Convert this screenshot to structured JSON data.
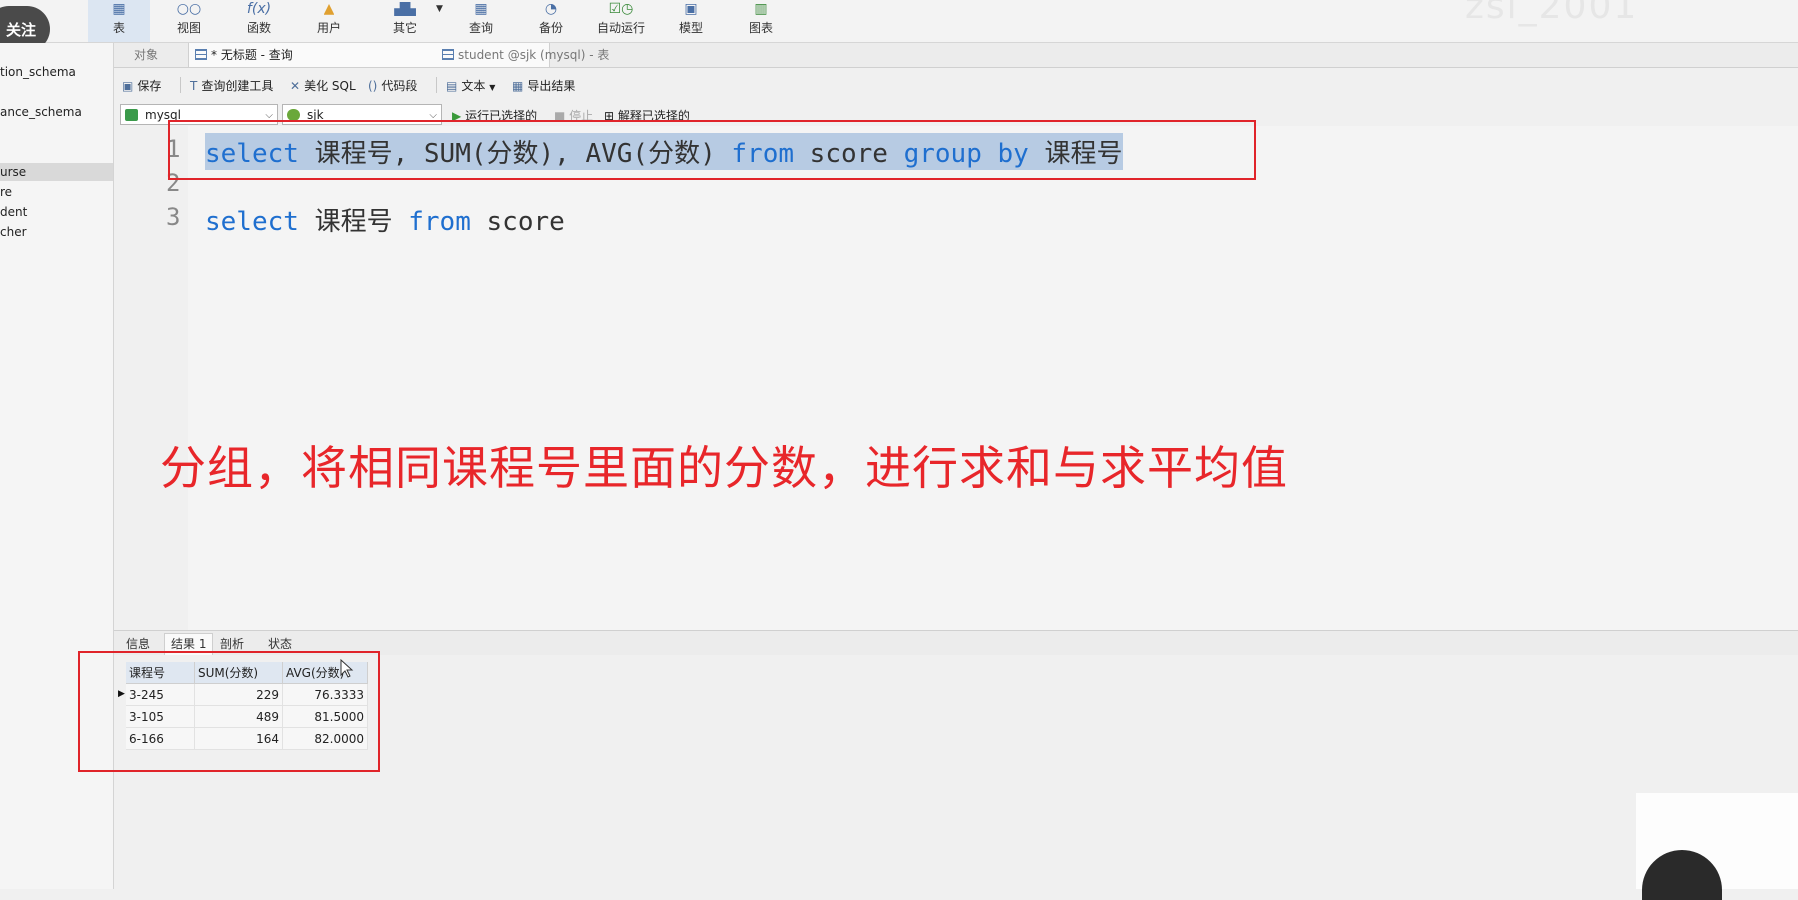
{
  "ribbon": {
    "follow_badge": "关注",
    "watermark": "zsl_2001",
    "buttons": [
      {
        "label": "表",
        "icon": "table-icon"
      },
      {
        "label": "视图",
        "icon": "view-icon"
      },
      {
        "label": "函数",
        "icon": "function-icon",
        "glyph": "f(x)"
      },
      {
        "label": "用户",
        "icon": "user-icon"
      },
      {
        "label": "其它",
        "icon": "other-icon"
      },
      {
        "label": "查询",
        "icon": "query-icon"
      },
      {
        "label": "备份",
        "icon": "backup-icon"
      },
      {
        "label": "自动运行",
        "icon": "auto-run-icon"
      },
      {
        "label": "模型",
        "icon": "model-icon"
      },
      {
        "label": "图表",
        "icon": "chart-icon"
      }
    ]
  },
  "navigator": {
    "items": [
      {
        "label": "tion_schema"
      },
      {
        "label": "ance_schema"
      },
      {
        "label": "urse"
      },
      {
        "label": "re"
      },
      {
        "label": "dent"
      },
      {
        "label": "cher"
      }
    ]
  },
  "tabs": [
    {
      "label": "对象"
    },
    {
      "label": "* 无标题 - 查询"
    },
    {
      "label": "student @sjk (mysql) - 表"
    }
  ],
  "toolbar": {
    "save": "保存",
    "query_builder": "查询创建工具",
    "beautify": "美化 SQL",
    "snippet": "代码段",
    "text": "文本",
    "export": "导出结果"
  },
  "selectors": {
    "connection": "mysql",
    "database": "sjk",
    "run_selected": "运行已选择的",
    "stop": "停止",
    "explain_selected": "解释已选择的"
  },
  "editor": {
    "lines": [
      {
        "no": "1",
        "select": "select",
        "text1": " 课程号, SUM(分数), AVG(分数) ",
        "from": "from",
        "text2": " score ",
        "group": "group",
        "by": "by",
        "text3": " 课程号"
      },
      {
        "no": "2"
      },
      {
        "no": "3",
        "select": "select",
        "text1": " 课程号 ",
        "from": "from",
        "text2": " score"
      }
    ]
  },
  "annotation": "分组，将相同课程号里面的分数，进行求和与求平均值",
  "result_tabs": [
    {
      "label": "信息"
    },
    {
      "label": "结果 1"
    },
    {
      "label": "剖析"
    },
    {
      "label": "状态"
    }
  ],
  "result": {
    "columns": [
      "课程号",
      "SUM(分数)",
      "AVG(分数)"
    ],
    "rows": [
      [
        "3-245",
        "229",
        "76.3333"
      ],
      [
        "3-105",
        "489",
        "81.5000"
      ],
      [
        "6-166",
        "164",
        "82.0000"
      ]
    ]
  },
  "colors": {
    "keyword": "#1f6fcf",
    "annotation": "#e8262a",
    "selection": "#b7cbe3"
  }
}
